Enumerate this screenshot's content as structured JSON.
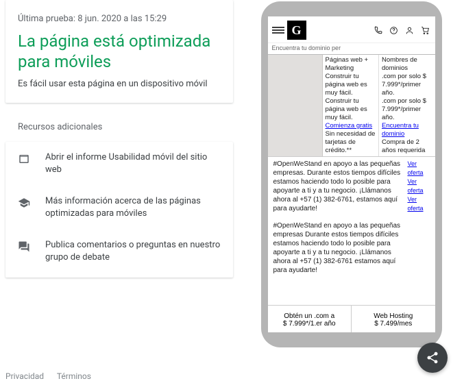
{
  "result": {
    "last_test": "Última prueba: 8 jun. 2020 a las 15:29",
    "headline": "La página está optimizada para móviles",
    "subtext": "Es fácil usar esta página en un dispositivo móvil"
  },
  "resources": {
    "title": "Recursos adicionales",
    "items": {
      "0": {
        "label": "Abrir el informe Usabilidad móvil del sitio web"
      },
      "1": {
        "label": "Más información acerca de las páginas optimizadas para móviles"
      },
      "2": {
        "label": "Publica comentarios o preguntas en nuestro grupo de debate"
      }
    }
  },
  "footer": {
    "privacy": "Privacidad",
    "terms": "Términos"
  },
  "preview": {
    "search_placeholder": "Encuentra tu dominio per",
    "col2": {
      "h": "Páginas web + Marketing",
      "l1": "Construir tu página web es muy fácil.",
      "l2": "Construir tu página web es muy fácil.",
      "link": "Comienza gratis",
      "l3": "Sin necesidad de tarjetas de crédito.**"
    },
    "col3": {
      "h": "Nombres de dominios",
      "l1": ".com por solo $ 7.999*/primer año.",
      "l2": ".com por solo $ 7.999*/primer año.",
      "link": "Encuentra tu dominio",
      "l3": "Compra de 2 años requerida"
    },
    "body": {
      "p1": "#OpenWeStand en apoyo a las pequeñas empresas. Durante estos tiempos difíciles estamos haciendo todo lo posible para apoyarte a ti y a tu negocio. ¡Llámanos ahora al +57 (1) 382-6761, estamos aquí para ayudarte!",
      "p2": "#OpenWeStand en apoyo a las pequeñas empresas Durante estos tiempos difíciles estamos haciendo todo lo posible para apoyarte a ti y a tu negocio. ¡Llámanos ahora al +57 (1) 382-6761 estamos aquí para ayudarte!",
      "side": "Ver oferta"
    },
    "offers": {
      "o1a": "Obtén un .com a",
      "o1b": "$ 7.999*/1.er año",
      "o2a": "Web Hosting",
      "o2b": "$ 7.499/mes"
    }
  }
}
